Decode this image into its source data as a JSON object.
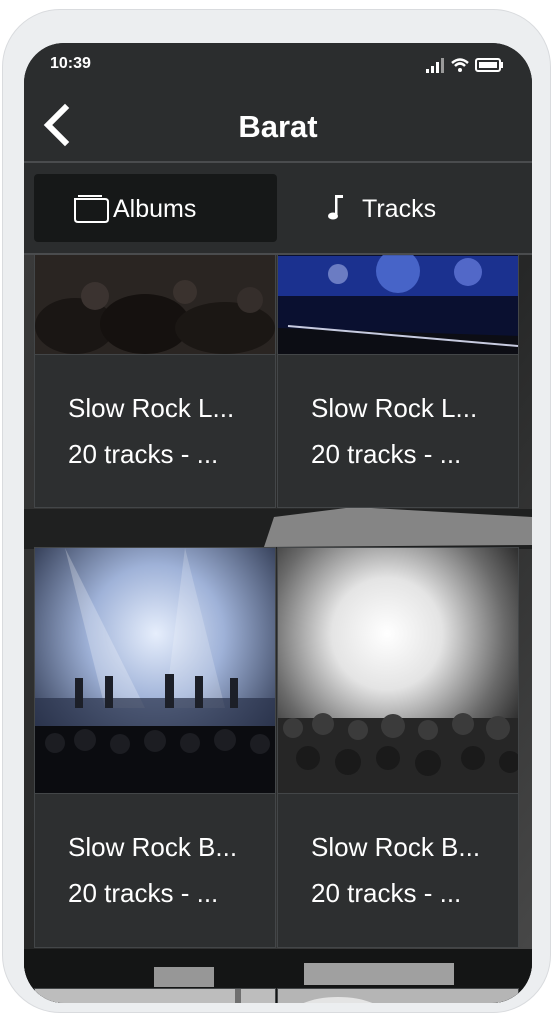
{
  "status_bar": {
    "time": "10:39"
  },
  "header": {
    "title": "Barat",
    "back_icon": "chevron-left-icon"
  },
  "tabs": [
    {
      "label": "Albums",
      "icon": "album-icon",
      "selected": true
    },
    {
      "label": "Tracks",
      "icon": "music-note-icon",
      "selected": false
    }
  ],
  "albums": [
    {
      "title": "Slow Rock L...",
      "subtitle": "20 tracks - ..."
    },
    {
      "title": "Slow Rock L...",
      "subtitle": "20 tracks - ..."
    },
    {
      "title": "Slow Rock B...",
      "subtitle": "20 tracks - ..."
    },
    {
      "title": "Slow Rock B...",
      "subtitle": "20 tracks - ..."
    }
  ],
  "colors": {
    "background": "#1d1f20",
    "bar": "#2b2d2e",
    "card": "#2d2f30",
    "selected_tab": "#161818",
    "text": "#ffffff"
  }
}
